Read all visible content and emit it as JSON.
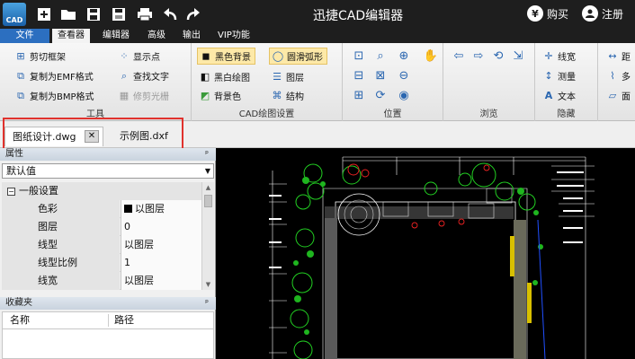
{
  "titlebar": {
    "logo_text": "CAD",
    "title": "迅捷CAD编辑器",
    "buy_icon": "¥",
    "buy_label": "购买",
    "register_label": "注册"
  },
  "menu": {
    "file": "文件",
    "items": [
      "查看器",
      "编辑器",
      "高级",
      "输出",
      "VIP功能"
    ]
  },
  "ribbon": {
    "tools": {
      "label": "工具",
      "items": [
        "剪切框架",
        "复制为EMF格式",
        "复制为BMP格式",
        "显示点",
        "查找文字",
        "修剪光栅"
      ]
    },
    "cad_settings": {
      "label": "CAD绘图设置",
      "items": [
        "黑色背景",
        "黑白绘图",
        "背景色",
        "圆滑弧形",
        "图层",
        "结构"
      ]
    },
    "position": {
      "label": "位置"
    },
    "browse": {
      "label": "浏览"
    },
    "hide": {
      "label": "隐藏",
      "items": [
        "线宽",
        "测量",
        "文本"
      ]
    },
    "partial": {
      "items": [
        "距",
        "多",
        "面"
      ]
    }
  },
  "tabs": {
    "items": [
      "图纸设计.dwg",
      "示例图.dxf"
    ],
    "close_glyph": "✕"
  },
  "properties": {
    "header": "属性",
    "pin": "ᵖ",
    "selected": "默认值",
    "section": "一般设置",
    "rows": [
      {
        "key": "色彩",
        "value": "以图层"
      },
      {
        "key": "图层",
        "value": "0"
      },
      {
        "key": "线型",
        "value": "以图层"
      },
      {
        "key": "线型比例",
        "value": "1"
      },
      {
        "key": "线宽",
        "value": "以图层"
      }
    ]
  },
  "favorites": {
    "header": "收藏夹",
    "columns": [
      "名称",
      "路径"
    ]
  },
  "colors": {
    "title_bg": "#1e1e1e",
    "file_tab": "#2c6fc0",
    "highlight": "#fde9a8",
    "callout": "#e0322d"
  }
}
